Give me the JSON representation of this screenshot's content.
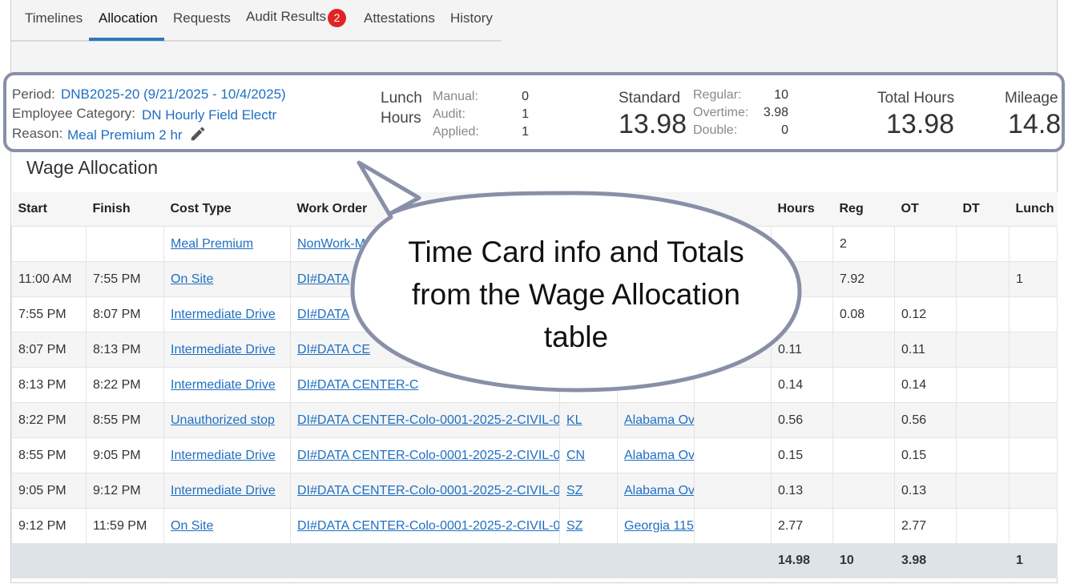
{
  "tabs": [
    {
      "label": "Timelines"
    },
    {
      "label": "Allocation"
    },
    {
      "label": "Requests"
    },
    {
      "label": "Audit Results",
      "badge": "2"
    },
    {
      "label": "Attestations"
    },
    {
      "label": "History"
    }
  ],
  "info": {
    "period_label": "Period:",
    "period_value": "DNB2025-20 (9/21/2025 - 10/4/2025)",
    "category_label": "Employee Category:",
    "category_value": "DN Hourly Field Electr",
    "reason_label": "Reason:",
    "reason_value": "Meal Premium 2 hr",
    "lunch_title_1": "Lunch",
    "lunch_title_2": "Hours",
    "lunch": [
      {
        "label": "Manual:",
        "value": "0"
      },
      {
        "label": "Audit:",
        "value": "1"
      },
      {
        "label": "Applied:",
        "value": "1"
      }
    ],
    "standard_title": "Standard",
    "standard_value": "13.98",
    "standard_breakdown": [
      {
        "label": "Regular:",
        "value": "10"
      },
      {
        "label": "Overtime:",
        "value": "3.98"
      },
      {
        "label": "Double:",
        "value": "0"
      }
    ],
    "total_title": "Total Hours",
    "total_value": "13.98",
    "mileage_title": "Mileage",
    "mileage_value": "14.8"
  },
  "section_title": "Wage Allocation",
  "table": {
    "columns": [
      "Start",
      "Finish",
      "Cost Type",
      "Work Order",
      "",
      "",
      "",
      "Hours",
      "Reg",
      "OT",
      "DT",
      "Lunch"
    ],
    "rows": [
      [
        "",
        "",
        "Meal Premium",
        "NonWork-M",
        "",
        "",
        "",
        "",
        "2",
        "",
        "",
        ""
      ],
      [
        "11:00 AM",
        "7:55 PM",
        "On Site",
        "DI#DATA",
        "",
        "",
        "",
        "",
        "7.92",
        "",
        "",
        "1"
      ],
      [
        "7:55 PM",
        "8:07 PM",
        "Intermediate Drive",
        "DI#DATA",
        "",
        "",
        "",
        "",
        "0.08",
        "0.12",
        "",
        ""
      ],
      [
        "8:07 PM",
        "8:13 PM",
        "Intermediate Drive",
        "DI#DATA CE",
        "",
        "",
        "",
        "0.11",
        "",
        "0.11",
        "",
        ""
      ],
      [
        "8:13 PM",
        "8:22 PM",
        "Intermediate Drive",
        "DI#DATA CENTER-C",
        "",
        "",
        "",
        "0.14",
        "",
        "0.14",
        "",
        ""
      ],
      [
        "8:22 PM",
        "8:55 PM",
        "Unauthorized stop",
        "DI#DATA CENTER-Colo-0001-2025-2-CIVIL-0",
        "KL",
        "Alabama Ov",
        "",
        "0.56",
        "",
        "0.56",
        "",
        ""
      ],
      [
        "8:55 PM",
        "9:05 PM",
        "Intermediate Drive",
        "DI#DATA CENTER-Colo-0001-2025-2-CIVIL-0",
        "CN",
        "Alabama Ov",
        "",
        "0.15",
        "",
        "0.15",
        "",
        ""
      ],
      [
        "9:05 PM",
        "9:12 PM",
        "Intermediate Drive",
        "DI#DATA CENTER-Colo-0001-2025-2-CIVIL-0",
        "SZ",
        "Alabama Ov",
        "",
        "0.13",
        "",
        "0.13",
        "",
        ""
      ],
      [
        "9:12 PM",
        "11:59 PM",
        "On Site",
        "DI#DATA CENTER-Colo-0001-2025-2-CIVIL-0",
        "SZ",
        "Georgia 115",
        "",
        "2.77",
        "",
        "2.77",
        "",
        ""
      ]
    ],
    "totals": [
      "",
      "",
      "",
      "",
      "",
      "",
      "",
      "14.98",
      "10",
      "3.98",
      "",
      "1"
    ]
  },
  "callout_text": "Time Card info and Totals from the Wage Allocation table",
  "colors": {
    "link": "#1f6fc2",
    "active_tab": "#2a7ac0",
    "badge": "#e02424",
    "callout_border": "#8a8fa8",
    "total_row": "#dde3e8"
  }
}
